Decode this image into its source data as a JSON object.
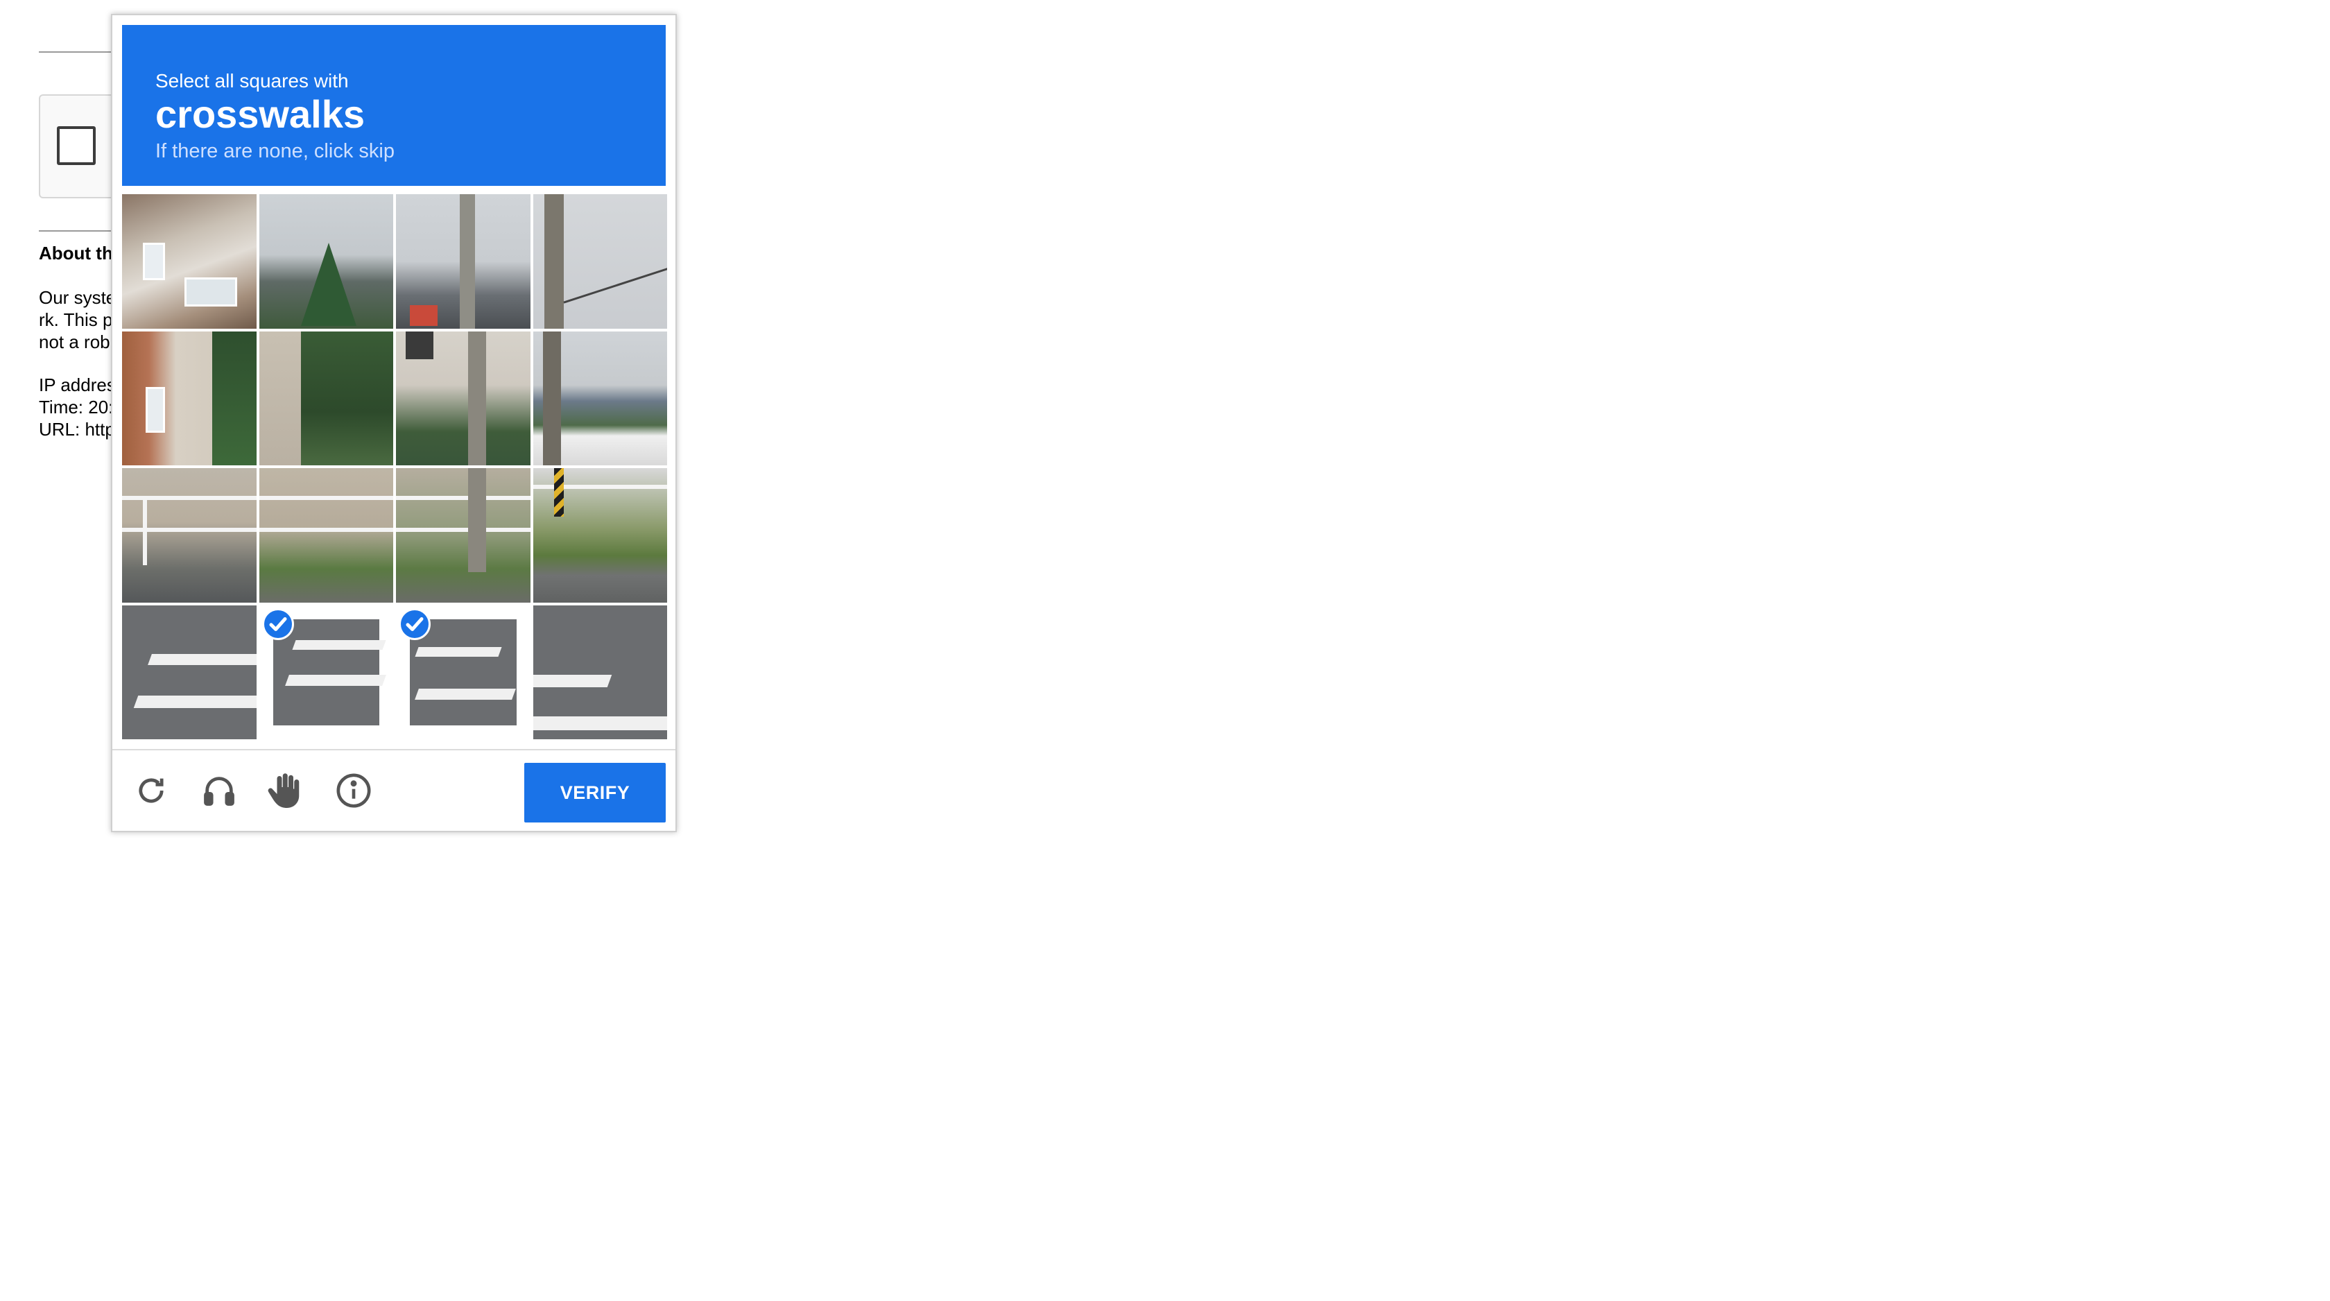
{
  "background": {
    "section_heading": "About th",
    "description_lines": [
      "Our syste",
      "rk. This p",
      "not a rob"
    ],
    "info_lines": [
      "IP addres",
      "Time: 20:",
      "URL: http"
    ]
  },
  "captcha": {
    "instruction": "Select all squares with",
    "target": "crosswalks",
    "hint": "If there are none, click skip",
    "grid": {
      "rows": 4,
      "cols": 4,
      "selected_tiles": [
        13,
        14
      ]
    },
    "footer": {
      "icons": [
        "reload-icon",
        "audio-icon",
        "hand-icon",
        "info-icon"
      ],
      "verify_label": "VERIFY"
    },
    "colors": {
      "accent": "#1a73e8",
      "hint_text": "#cfe0ff"
    }
  }
}
